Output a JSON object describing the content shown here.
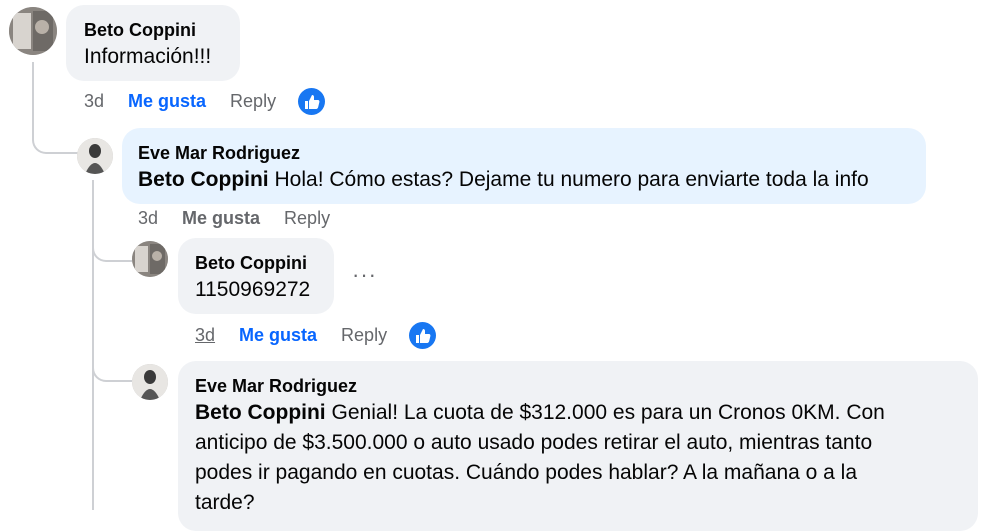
{
  "comments": [
    {
      "author": "Beto Coppini",
      "mention": "",
      "text": "Información!!!",
      "time": "3d",
      "like_label": "Me gusta",
      "reply_label": "Reply",
      "liked": true
    },
    {
      "author": "Eve Mar Rodriguez",
      "mention": "Beto Coppini",
      "text": "Hola! Cómo estas? Dejame tu numero para enviarte toda la info",
      "time": "3d",
      "like_label": "Me gusta",
      "reply_label": "Reply",
      "liked": false
    },
    {
      "author": "Beto Coppini",
      "mention": "",
      "text": "1150969272",
      "time": "3d",
      "like_label": "Me gusta",
      "reply_label": "Reply",
      "liked": true,
      "more_label": "···"
    },
    {
      "author": "Eve Mar Rodriguez",
      "mention": "Beto Coppini",
      "text_lines": [
        "Genial! La cuota de $312.000 es para un Cronos 0KM. Con",
        "anticipo de $3.500.000 o auto usado podes retirar el auto, mientras tanto",
        "podes ir pagando en cuotas. Cuándo podes hablar? A la mañana o a la",
        "tarde?"
      ]
    }
  ],
  "colors": {
    "like_active": "#0866ff",
    "reaction_blue": "#1877f2",
    "bubble_gray": "#f0f2f5",
    "bubble_blue": "#e7f3ff",
    "meta_gray": "#65676b"
  },
  "icons": {
    "reaction": "thumbs-up-icon",
    "menu": "more-options-icon"
  }
}
